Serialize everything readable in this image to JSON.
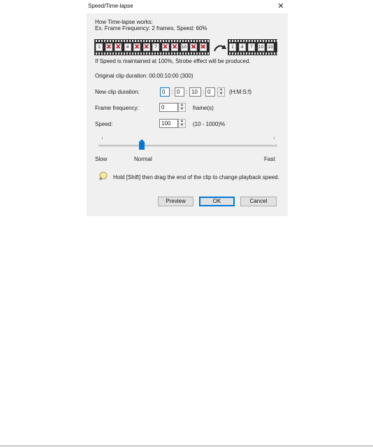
{
  "window": {
    "title": "Speed/Time-lapse"
  },
  "info": {
    "line1": "How Time-lapse works:",
    "line2": "Ex. Frame Frequency: 2 frames, Speed: 60%"
  },
  "film_strip": {
    "source_frames": [
      {
        "label": "1",
        "dropped": false
      },
      {
        "label": "2",
        "dropped": true
      },
      {
        "label": "3",
        "dropped": true
      },
      {
        "label": "4",
        "dropped": false
      },
      {
        "label": "5",
        "dropped": true
      },
      {
        "label": "6",
        "dropped": true
      },
      {
        "label": "7",
        "dropped": false
      },
      {
        "label": "8",
        "dropped": true
      },
      {
        "label": "9",
        "dropped": true
      },
      {
        "label": "10",
        "dropped": false
      },
      {
        "label": "11",
        "dropped": true
      },
      {
        "label": "12",
        "dropped": true
      }
    ],
    "result_frames": [
      "1",
      "4",
      "7",
      "10",
      "13"
    ],
    "arrow_icon": "curved-arrow-right-icon"
  },
  "strobe_note": "If Speed is maintained at 100%, Strobe effect will be produced.",
  "original_duration": "Original clip duration: 00:00:10:00 (300)",
  "new_duration": {
    "label": "New clip duration:",
    "h": "0",
    "m": "0",
    "s": "10",
    "f": "0",
    "format": "(H:M:S:f)"
  },
  "frame_frequency": {
    "label": "Frame frequency:",
    "value": "0",
    "unit": "frame(s)"
  },
  "speed": {
    "label": "Speed:",
    "value": "100",
    "range": "(10 - 1000)%"
  },
  "slider": {
    "slow_label": "Slow",
    "normal_label": "Normal",
    "fast_label": "Fast",
    "position_fraction": 0.24
  },
  "hint": {
    "icon": "lightbulb-icon",
    "text": "Hold [Shift] then drag the end of the clip to change playback speed."
  },
  "buttons": {
    "preview": "Preview",
    "ok": "OK",
    "cancel": "Cancel"
  },
  "colors": {
    "dialog_bg": "#f0f0f0",
    "accent": "#0078d7",
    "drop_mark": "#cc1f2a"
  }
}
